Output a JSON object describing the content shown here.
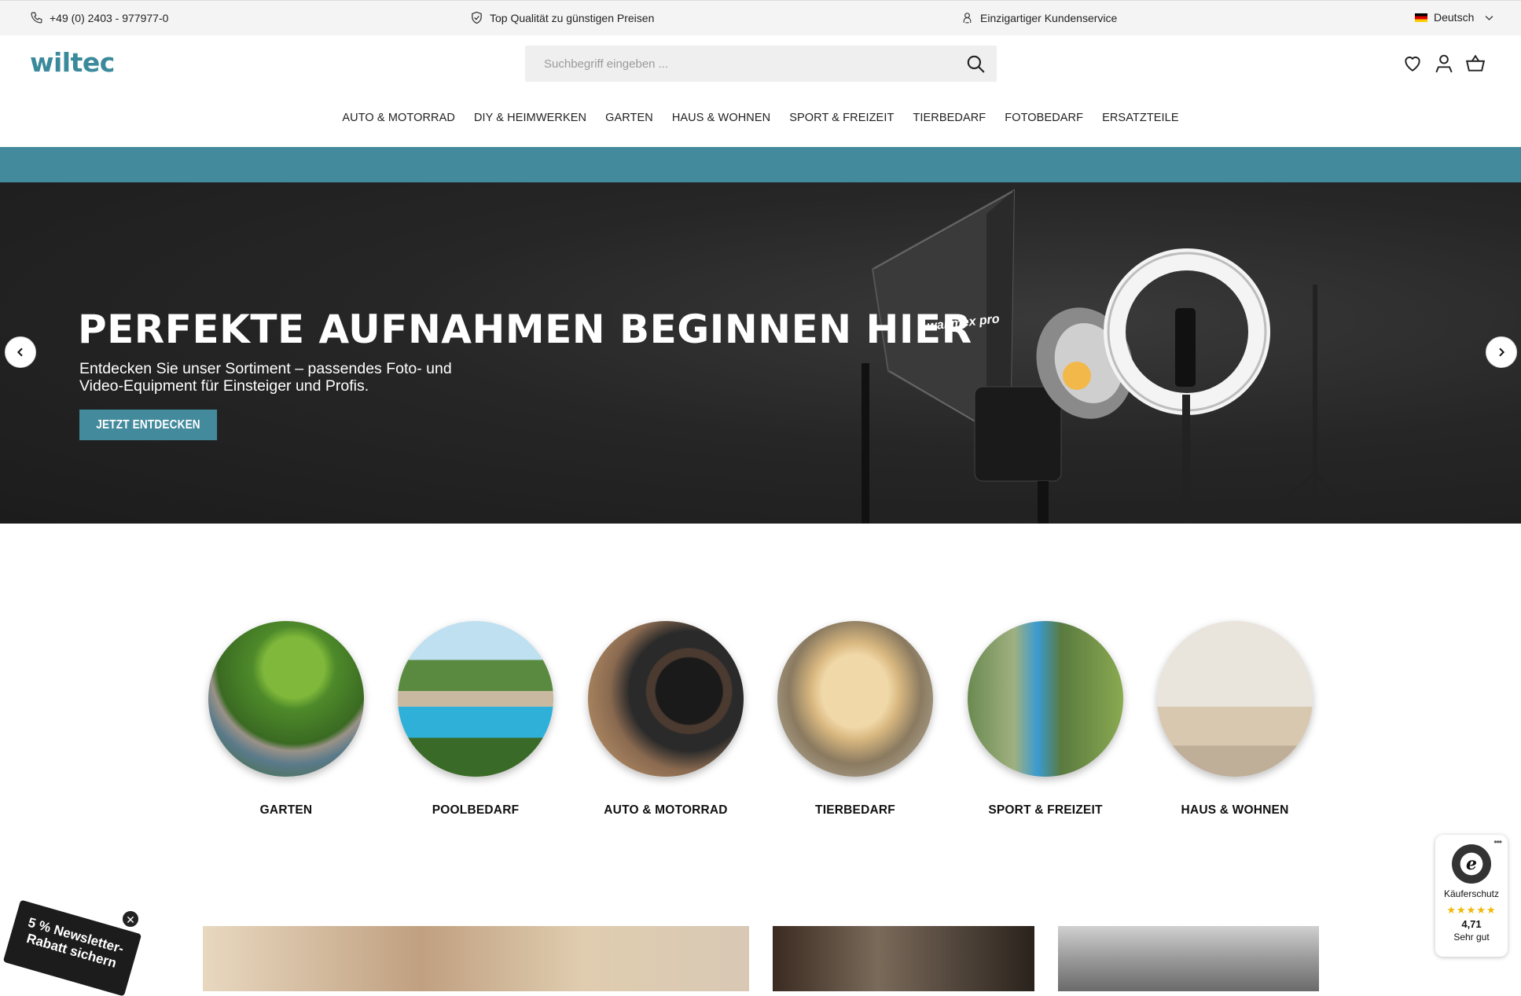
{
  "topbar": {
    "phone": "+49 (0) 2403 - 977977-0",
    "quality": "Top Qualität zu günstigen Preisen",
    "service": "Einzigartiger Kundenservice",
    "language": "Deutsch"
  },
  "header": {
    "logo": "wiltec",
    "search_placeholder": "Suchbegriff eingeben ..."
  },
  "nav": {
    "items": [
      "AUTO & MOTORRAD",
      "DIY & HEIMWERKEN",
      "GARTEN",
      "HAUS & WOHNEN",
      "SPORT & FREIZEIT",
      "TIERBEDARF",
      "FOTOBEDARF",
      "ERSATZTEILE"
    ]
  },
  "hero": {
    "title": "PERFEKTE AUFNAHMEN BEGINNEN HIER",
    "subtitle": "Entdecken Sie unser Sortiment – passendes Foto- und Video-Equipment für Einsteiger und Profis.",
    "button": "JETZT ENTDECKEN",
    "product_brand": "walimex pro"
  },
  "categories": {
    "items": [
      "GARTEN",
      "POOLBEDARF",
      "AUTO & MOTORRAD",
      "TIERBEDARF",
      "SPORT & FREIZEIT",
      "HAUS & WOHNEN"
    ]
  },
  "trusted_shops": {
    "label": "Käuferschutz",
    "stars": "★★★★★",
    "rating": "4,71",
    "grade": "Sehr gut"
  },
  "newsletter": {
    "text": "5 % Newsletter-Rabatt sichern"
  },
  "colors": {
    "brand": "#428a9c"
  }
}
